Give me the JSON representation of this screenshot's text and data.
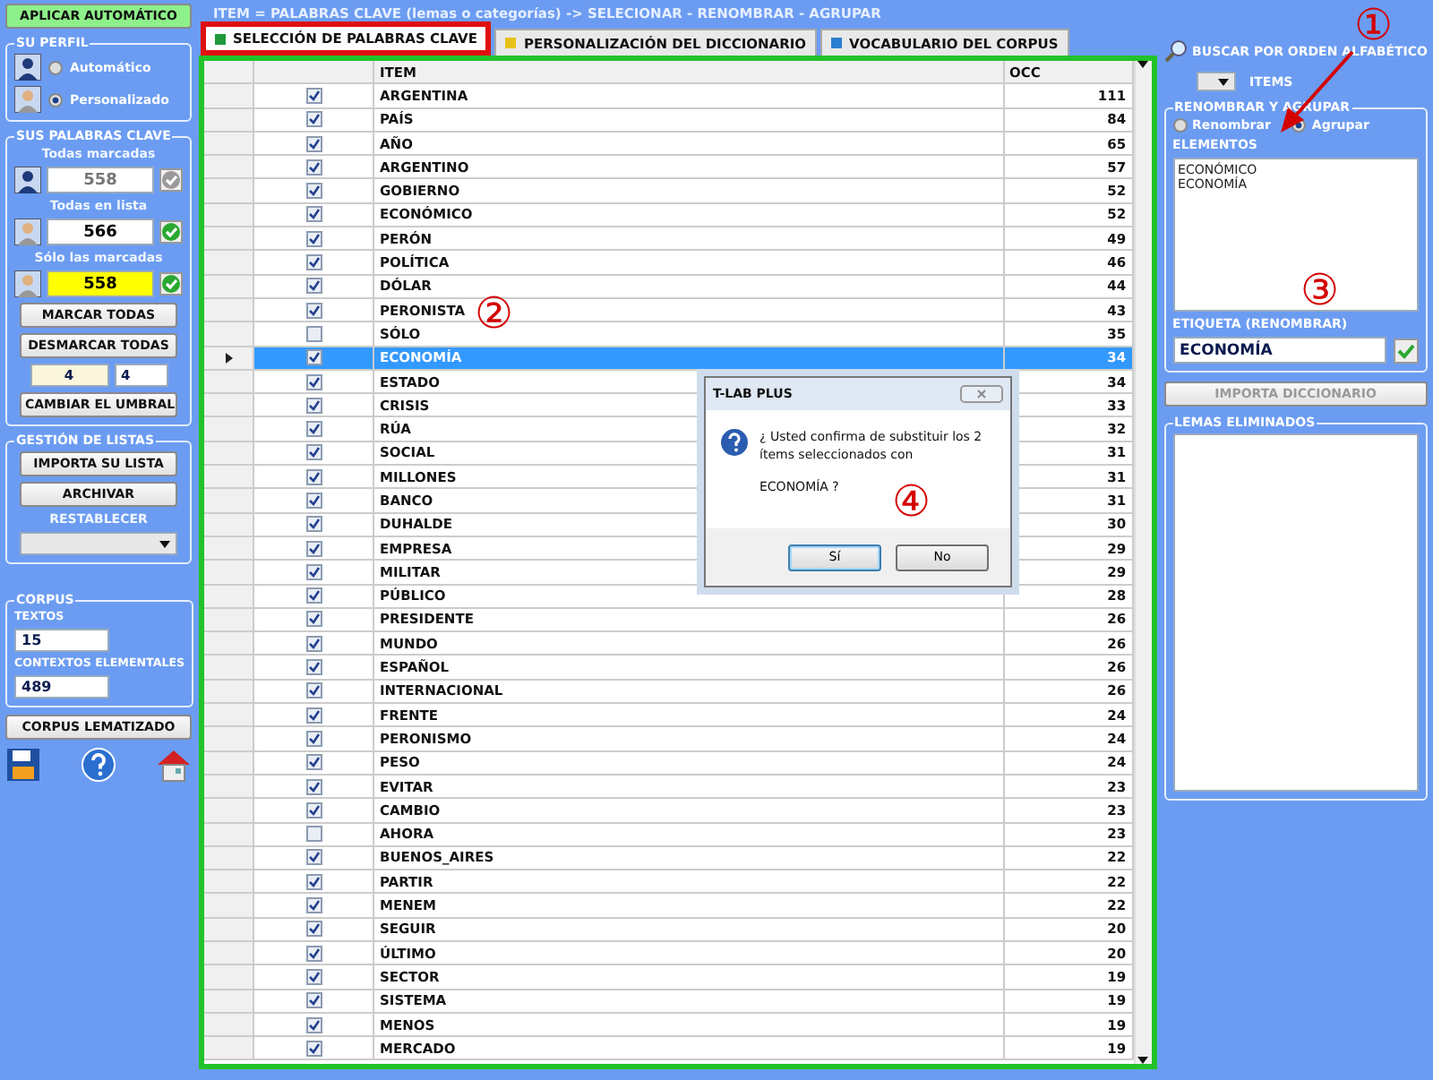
{
  "header_title": "ITEM = PALABRAS CLAVE (lemas o categorías) -> SELECIONAR - RENOMBRAR - AGRUPAR",
  "left": {
    "apply_button": "APLICAR AUTOMÁTICO",
    "profile": {
      "title": "SU PERFIL",
      "options": [
        {
          "label": "Automático",
          "selected": false
        },
        {
          "label": "Personalizado",
          "selected": true
        }
      ]
    },
    "keywords": {
      "title": "SUS PALABRAS CLAVE",
      "counts": [
        {
          "label": "Todas marcadas",
          "value": "558",
          "highlight": false,
          "confirmed": false
        },
        {
          "label": "Todas en lista",
          "value": "566",
          "highlight": false,
          "confirmed": true
        },
        {
          "label": "Sólo las marcadas",
          "value": "558",
          "highlight": true,
          "confirmed": true
        }
      ],
      "buttons": [
        "MARCAR TODAS",
        "DESMARCAR TODAS"
      ],
      "threshold": "4",
      "spinner": "4",
      "threshold_button": "CAMBIAR EL UMBRAL"
    },
    "lists": {
      "title": "GESTIÓN DE LISTAS",
      "buttons": [
        "IMPORTA SU LISTA",
        "ARCHIVAR"
      ],
      "restore_label": "RESTABLECER"
    },
    "corpus": {
      "title": "CORPUS",
      "fields": [
        {
          "label": "TEXTOS",
          "value": "15"
        },
        {
          "label": "CONTEXTOS ELEMENTALES",
          "value": "489"
        }
      ]
    },
    "lemmatized_button": "CORPUS LEMATIZADO"
  },
  "tabs": [
    {
      "label": "SELECCIÓN DE PALABRAS CLAVE",
      "selected": true,
      "color": "#1e9a3c",
      "outlined": true
    },
    {
      "label": "PERSONALIZACIÓN DEL DICCIONARIO",
      "selected": false,
      "color": "#e8c21a",
      "outlined": false
    },
    {
      "label": "VOCABULARIO DEL CORPUS",
      "selected": false,
      "color": "#2a7fd0",
      "outlined": false
    }
  ],
  "table": {
    "columns": [
      "ITEM",
      "OCC"
    ],
    "rows": [
      {
        "item": "ARGENTINA",
        "occ": "111",
        "checked": true,
        "selected": false
      },
      {
        "item": "PAÍS",
        "occ": "84",
        "checked": true,
        "selected": false
      },
      {
        "item": "AÑO",
        "occ": "65",
        "checked": true,
        "selected": false
      },
      {
        "item": "ARGENTINO",
        "occ": "57",
        "checked": true,
        "selected": false
      },
      {
        "item": "GOBIERNO",
        "occ": "52",
        "checked": true,
        "selected": false
      },
      {
        "item": "ECONÓMICO",
        "occ": "52",
        "checked": true,
        "selected": false
      },
      {
        "item": "PERÓN",
        "occ": "49",
        "checked": true,
        "selected": false
      },
      {
        "item": "POLÍTICA",
        "occ": "46",
        "checked": true,
        "selected": false
      },
      {
        "item": "DÓLAR",
        "occ": "44",
        "checked": true,
        "selected": false
      },
      {
        "item": "PERONISTA",
        "occ": "43",
        "checked": true,
        "selected": false
      },
      {
        "item": "SÓLO",
        "occ": "35",
        "checked": false,
        "selected": false
      },
      {
        "item": "ECONOMÍA",
        "occ": "34",
        "checked": true,
        "selected": true
      },
      {
        "item": "ESTADO",
        "occ": "34",
        "checked": true,
        "selected": false
      },
      {
        "item": "CRISIS",
        "occ": "33",
        "checked": true,
        "selected": false
      },
      {
        "item": "RÚA",
        "occ": "32",
        "checked": true,
        "selected": false
      },
      {
        "item": "SOCIAL",
        "occ": "31",
        "checked": true,
        "selected": false
      },
      {
        "item": "MILLONES",
        "occ": "31",
        "checked": true,
        "selected": false
      },
      {
        "item": "BANCO",
        "occ": "31",
        "checked": true,
        "selected": false
      },
      {
        "item": "DUHALDE",
        "occ": "30",
        "checked": true,
        "selected": false
      },
      {
        "item": "EMPRESA",
        "occ": "29",
        "checked": true,
        "selected": false
      },
      {
        "item": "MILITAR",
        "occ": "29",
        "checked": true,
        "selected": false
      },
      {
        "item": "PÚBLICO",
        "occ": "28",
        "checked": true,
        "selected": false
      },
      {
        "item": "PRESIDENTE",
        "occ": "26",
        "checked": true,
        "selected": false
      },
      {
        "item": "MUNDO",
        "occ": "26",
        "checked": true,
        "selected": false
      },
      {
        "item": "ESPAÑOL",
        "occ": "26",
        "checked": true,
        "selected": false
      },
      {
        "item": "INTERNACIONAL",
        "occ": "26",
        "checked": true,
        "selected": false
      },
      {
        "item": "FRENTE",
        "occ": "24",
        "checked": true,
        "selected": false
      },
      {
        "item": "PERONISMO",
        "occ": "24",
        "checked": true,
        "selected": false
      },
      {
        "item": "PESO",
        "occ": "24",
        "checked": true,
        "selected": false
      },
      {
        "item": "EVITAR",
        "occ": "23",
        "checked": true,
        "selected": false
      },
      {
        "item": "CAMBIO",
        "occ": "23",
        "checked": true,
        "selected": false
      },
      {
        "item": "AHORA",
        "occ": "23",
        "checked": false,
        "selected": false
      },
      {
        "item": "BUENOS_AIRES",
        "occ": "22",
        "checked": true,
        "selected": false
      },
      {
        "item": "PARTIR",
        "occ": "22",
        "checked": true,
        "selected": false
      },
      {
        "item": "MENEM",
        "occ": "22",
        "checked": true,
        "selected": false
      },
      {
        "item": "SEGUIR",
        "occ": "20",
        "checked": true,
        "selected": false
      },
      {
        "item": "ÚLTIMO",
        "occ": "20",
        "checked": true,
        "selected": false
      },
      {
        "item": "SECTOR",
        "occ": "19",
        "checked": true,
        "selected": false
      },
      {
        "item": "SISTEMA",
        "occ": "19",
        "checked": true,
        "selected": false
      },
      {
        "item": "MENOS",
        "occ": "19",
        "checked": true,
        "selected": false
      },
      {
        "item": "MERCADO",
        "occ": "19",
        "checked": true,
        "selected": false
      }
    ]
  },
  "right": {
    "search_label": "BUSCAR POR ORDEN ALFABÉTICO",
    "items_label": "ITEMS",
    "group": {
      "title": "RENOMBRAR Y AGRUPAR",
      "options": [
        {
          "label": "Renombrar",
          "selected": false
        },
        {
          "label": "Agrupar",
          "selected": true
        }
      ],
      "elements_label": "ELEMENTOS",
      "elements": [
        "ECONÓMICO",
        "ECONOMÍA"
      ],
      "tag_label": "ETIQUETA (RENOMBRAR)",
      "tag_value": "ECONOMÍA"
    },
    "import_button": {
      "label": "IMPORTA DICCIONARIO",
      "disabled": true
    },
    "removed_title": "LEMAS ELIMINADOS"
  },
  "dialog": {
    "title": "T-LAB PLUS",
    "message": "¿ Usted confirma de substituir los 2 ítems seleccionados con",
    "term": "ECONOMÍA ?",
    "buttons": [
      {
        "label": "Sí",
        "selected": true
      },
      {
        "label": "No",
        "selected": false
      }
    ]
  },
  "annotations": [
    {
      "label": "①"
    },
    {
      "label": "②"
    },
    {
      "label": "③"
    },
    {
      "label": "④"
    }
  ]
}
